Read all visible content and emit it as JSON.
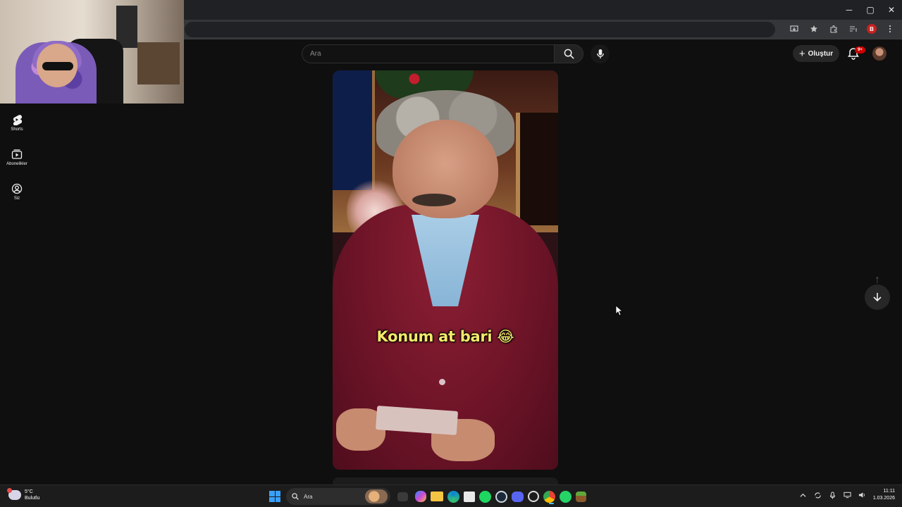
{
  "browser": {
    "window_controls": {
      "minimize": "─",
      "restore": "▢",
      "close": "✕"
    },
    "profile_letter": "B"
  },
  "sidebar": {
    "items": [
      {
        "label": "Shorts",
        "icon": "shorts-icon"
      },
      {
        "label": "Abonelikler",
        "icon": "subscriptions-icon"
      },
      {
        "label": "Siz",
        "icon": "account-icon"
      }
    ]
  },
  "header": {
    "search_placeholder": "Ara",
    "create_label": "Oluştur",
    "notification_badge": "9+"
  },
  "short": {
    "caption": "Konum at bari 😂"
  },
  "navigation": {
    "up": "↑",
    "down": "↓"
  },
  "taskbar": {
    "weather_temp": "5°C",
    "weather_desc": "Bulutlu",
    "search_label": "Ara",
    "time": "11:11",
    "date": "1.03.2026",
    "colors": {
      "accent": "#4cc2ff",
      "windows": "#3aa0ff"
    }
  }
}
